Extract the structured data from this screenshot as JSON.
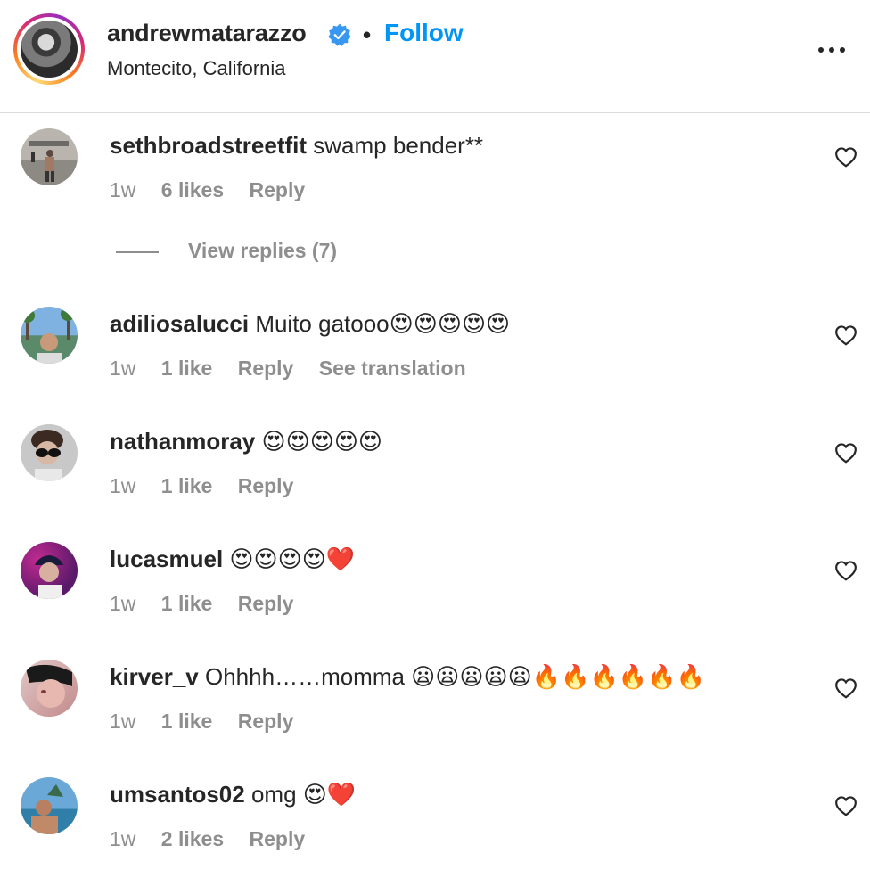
{
  "post_header": {
    "username": "andrewmatarazzo",
    "separator": "•",
    "follow_label": "Follow",
    "location": "Montecito, California",
    "accent_color": "#0095f6"
  },
  "comments": [
    {
      "username": "sethbroadstreetfit",
      "text": "swamp bender**",
      "time": "1w",
      "likes": "6 likes",
      "reply": "Reply",
      "translate": ""
    },
    {
      "username": "adiliosalucci",
      "text": "Muito gatooo😍😍😍😍😍",
      "time": "1w",
      "likes": "1 like",
      "reply": "Reply",
      "translate": "See translation"
    },
    {
      "username": "nathanmoray",
      "text": "😍😍😍😍😍",
      "time": "1w",
      "likes": "1 like",
      "reply": "Reply",
      "translate": ""
    },
    {
      "username": "lucasmuel",
      "text": "😍😍😍😍❤️",
      "time": "1w",
      "likes": "1 like",
      "reply": "Reply",
      "translate": ""
    },
    {
      "username": "kirver_v",
      "text": "Ohhhh……momma 😦😦😦😦😦🔥🔥🔥🔥🔥🔥",
      "time": "1w",
      "likes": "1 like",
      "reply": "Reply",
      "translate": ""
    },
    {
      "username": "umsantos02",
      "text": "omg 😍❤️",
      "time": "1w",
      "likes": "2 likes",
      "reply": "Reply",
      "translate": ""
    }
  ],
  "view_replies": {
    "label": "View replies (7)"
  },
  "icons": {
    "verified": "verified-badge-icon",
    "more": "more-options-icon",
    "like": "heart-outline-icon"
  }
}
